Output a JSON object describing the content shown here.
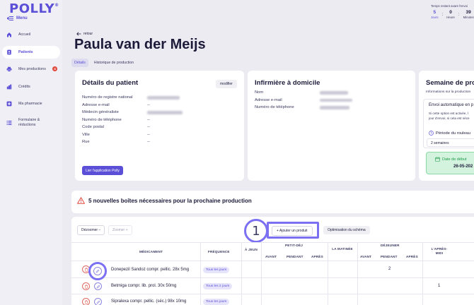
{
  "app": {
    "logo": "POLLY",
    "logo_mark": "®",
    "menu_label": "Menu"
  },
  "sidebar": {
    "items": [
      {
        "label": "Accueil",
        "icon": "home-icon"
      },
      {
        "label": "Patients",
        "icon": "patients-icon",
        "active": true
      },
      {
        "label": "Mes productions",
        "icon": "printer-icon",
        "badge": "4"
      },
      {
        "label": "Crédits",
        "icon": "credits-icon"
      },
      {
        "label": "Ma pharmacie",
        "icon": "pharmacy-icon"
      },
      {
        "label": "Formulaire & réductions",
        "label_line1": "Formulaire &",
        "label_line2": "réductions",
        "icon": "list-icon"
      }
    ]
  },
  "countdown": {
    "title": "Temps restant avant l'envoi",
    "days": "5",
    "days_label": "Jours",
    "hours": "0",
    "hours_label": "Heure",
    "minutes": "39",
    "minutes_label": "Minutes"
  },
  "header": {
    "back_label": "retour",
    "patient_name": "Paula van der Meijs",
    "tabs": [
      {
        "label": "Détails",
        "active": true
      },
      {
        "label": "Historique de production",
        "active": false
      }
    ]
  },
  "patient_card": {
    "title": "Détails du patient",
    "modify_label": "modifier",
    "fields": [
      {
        "label": "Numéro de registre national",
        "value": ""
      },
      {
        "label": "Adresse e-mail",
        "value": "--"
      },
      {
        "label": "Médecin généraliste",
        "value": ""
      },
      {
        "label": "Numéro de téléphone",
        "value": "--"
      },
      {
        "label": "Code postal",
        "value": "--"
      },
      {
        "label": "Ville",
        "value": "--"
      },
      {
        "label": "Rue",
        "value": "--"
      }
    ],
    "link_button": "Lier l'application Polly"
  },
  "nurse_card": {
    "title": "Infirmière à domicile",
    "fields": [
      {
        "label": "Nom",
        "value": ""
      },
      {
        "label": "Adresse e-mail",
        "value": ""
      },
      {
        "label": "Numéro de téléphone",
        "value": ""
      }
    ]
  },
  "week_card": {
    "title": "Semaine de pro",
    "subtitle": "Informations sur la production",
    "auto_title": "Envoi automatique en p",
    "auto_text_1": "Si cette option est activée, l",
    "auto_text_2": "jour d'envoi, si cela est néce",
    "cycle_label": "Période du rouleau",
    "cycle_value": "2 semaines",
    "date_label": "Date de début",
    "date_value": "26-05-202"
  },
  "warning": {
    "text": "5 nouvelles boîtes nécessaires pour la prochaine production",
    "color": "#e0473d"
  },
  "toolbar": {
    "zoom_out": "Dézoomer",
    "zoom_in": "Zoomer",
    "callout_number": "1",
    "add_product": "+ Ajouter un produit",
    "optimize": "Optimisation du schéma"
  },
  "table": {
    "headers": {
      "medication": "MÉDICAMENT",
      "frequency": "FRÉQUENCE",
      "fasting": "À JEUN",
      "breakfast": "PETIT-DÉJ",
      "before": "AVANT",
      "during": "PENDANT",
      "after": "APRÈS",
      "morning": "LA MATINÉE",
      "lunch": "DÉJEUNER",
      "lunch_before": "AVANT",
      "lunch_during": "PENDANT",
      "lunch_after": "APRÈS",
      "afternoon": "L'APRÈS-MIDI"
    },
    "rows": [
      {
        "name": "Donepezil Sandoz compr. pellic. 28x 5mg",
        "frequency": "Tous les jours",
        "lunch_during": "2",
        "afternoon": ""
      },
      {
        "name": "Betmiga compr. lib. prol. 30x 50mg",
        "frequency": "Tous les 2 jours",
        "lunch_during": "",
        "afternoon": "1"
      },
      {
        "name": "Sipralexa compr. pellic. (séc.) 98x 10mg",
        "frequency": "Tous les jours",
        "lunch_during": "",
        "afternoon": ""
      }
    ]
  },
  "colors": {
    "accent": "#5a4fd6",
    "callout": "#7b6ff2",
    "background": "#ecebf2"
  }
}
